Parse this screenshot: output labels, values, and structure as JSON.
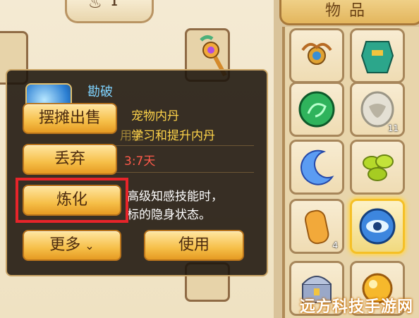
{
  "top_tab": {
    "glyph": "♨",
    "count": "1"
  },
  "bag": {
    "title": "物品"
  },
  "item": {
    "name": "勘破",
    "type_line": "宠物内丹",
    "use_prefix": "用途:",
    "use_line": "学习和提升内丹",
    "time_remaining": "3:7天",
    "desc_line1": "高级知感技能时，",
    "desc_line2": "标的隐身状态。"
  },
  "buttons": {
    "sell": "摆摊出售",
    "discard": "丢弃",
    "refine": "炼化",
    "more": "更多",
    "use": "使用"
  },
  "slots": [
    {
      "icon": "ornament-icon",
      "qty": ""
    },
    {
      "icon": "armor-icon",
      "qty": ""
    },
    {
      "icon": "jade-dragon-icon",
      "qty": ""
    },
    {
      "icon": "tiger-jade-icon",
      "qty": "11"
    },
    {
      "icon": "crescent-gem-icon",
      "qty": ""
    },
    {
      "icon": "green-beans-icon",
      "qty": ""
    },
    {
      "icon": "amber-stone-icon",
      "qty": "4"
    },
    {
      "icon": "eye-orb-icon",
      "qty": ""
    },
    {
      "icon": "treasure-chest-icon",
      "qty": ""
    },
    {
      "icon": "gold-orb-icon",
      "qty": ""
    }
  ],
  "watermark": "远方科技手游网",
  "colors": {
    "highlight": "#e7242a",
    "button": "#f6bf48",
    "selected": "#f5c026"
  }
}
